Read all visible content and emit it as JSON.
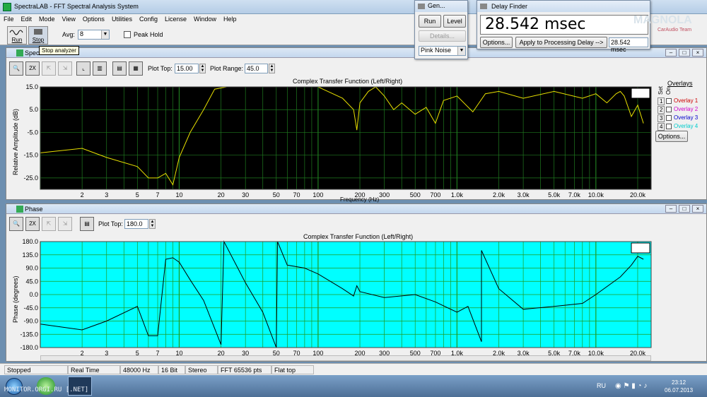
{
  "app": {
    "title": "SpectraLAB - FFT Spectral Analysis System"
  },
  "menu": [
    "File",
    "Edit",
    "Mode",
    "View",
    "Options",
    "Utilities",
    "Config",
    "License",
    "Window",
    "Help"
  ],
  "toolbar": {
    "run_label": "Run",
    "stop_label": "Stop",
    "avg_label": "Avg:",
    "avg_value": "8",
    "peak_hold_label": "Peak Hold",
    "tooltip": "Stop analyzer"
  },
  "gen": {
    "title": "Gen...",
    "run": "Run",
    "level": "Level",
    "details": "Details...",
    "noise": "Pink Noise"
  },
  "delay": {
    "title": "Delay Finder",
    "readout": "28.542 msec",
    "options": "Options...",
    "apply": "Apply to Processing Delay -->",
    "value": "28.542 msec"
  },
  "watermark": {
    "line1": "MAGNOLA",
    "line2": "CarAudio Team"
  },
  "spectrum": {
    "title": "Spectrum",
    "plot_top_label": "Plot Top:",
    "plot_top": "15.00",
    "plot_range_label": "Plot Range:",
    "plot_range": "45.0",
    "chart_title": "Complex Transfer Function (Left/Right)",
    "ylabel": "Relative Amplitude (dB)",
    "xlabel": "Frequency (Hz)",
    "yticks": [
      "15.0",
      "5.0",
      "-5.0",
      "-15.0",
      "-25.0"
    ],
    "set_label": "Set",
    "on_label": "On",
    "overlays_label": "Overlays",
    "overlays": [
      {
        "num": "1",
        "name": "Overlay 1",
        "color": "#cc0000"
      },
      {
        "num": "2",
        "name": "Overlay 2",
        "color": "#cc00cc"
      },
      {
        "num": "3",
        "name": "Overlay 3",
        "color": "#0000cc"
      },
      {
        "num": "4",
        "name": "Overlay 4",
        "color": "#00cccc"
      }
    ],
    "options_btn": "Options..."
  },
  "phase": {
    "title": "Phase",
    "plot_top_label": "Plot Top:",
    "plot_top": "180.0",
    "chart_title": "Complex Transfer Function (Left/Right)",
    "ylabel": "Phase (degrees)",
    "yticks": [
      "180.0",
      "135.0",
      "90.0",
      "45.0",
      "0.0",
      "-45.0",
      "-90.0",
      "-135.0",
      "-180.0"
    ]
  },
  "xticks": [
    "2",
    "3",
    "5",
    "7",
    "10",
    "20",
    "30",
    "50",
    "70",
    "100",
    "200",
    "300",
    "500",
    "700",
    "1.0k",
    "2.0k",
    "3.0k",
    "5.0k",
    "7.0k",
    "10.0k",
    "20.0k"
  ],
  "colors": {
    "spectrum_bg": "#000000",
    "spectrum_grid": "#1f7a1f",
    "spectrum_trace": "#e8e000",
    "phase_bg": "#00ffff",
    "phase_grid": "#1f9a1f",
    "phase_trace": "#000000"
  },
  "chart_data": [
    {
      "type": "line",
      "title": "Complex Transfer Function (Left/Right)",
      "xlabel": "Frequency (Hz)",
      "ylabel": "Relative Amplitude (dB)",
      "xscale": "log",
      "xlim": [
        1,
        25000
      ],
      "ylim": [
        -30,
        15
      ],
      "grid": true,
      "x": [
        1,
        2,
        3,
        5,
        6,
        7,
        8,
        9,
        10,
        12,
        15,
        18,
        22,
        100,
        150,
        180,
        190,
        200,
        230,
        260,
        300,
        350,
        400,
        500,
        600,
        700,
        800,
        1000,
        1300,
        1600,
        2000,
        3000,
        5000,
        8000,
        10000,
        12000,
        14000,
        15000,
        16000,
        18000,
        20000,
        22000
      ],
      "values": [
        -14,
        -12,
        -16,
        -20,
        -25,
        -25,
        -23,
        -28,
        -16,
        -5,
        5,
        14,
        15,
        15,
        10,
        5,
        -4,
        8,
        13,
        15,
        11,
        5,
        8,
        3,
        6,
        -1,
        9,
        11,
        4,
        12,
        13,
        10,
        13,
        10,
        12,
        8,
        12,
        13,
        11,
        2,
        7,
        -1
      ]
    },
    {
      "type": "line",
      "title": "Complex Transfer Function (Left/Right)",
      "ylabel": "Phase (degrees)",
      "xscale": "log",
      "xlim": [
        1,
        25000
      ],
      "ylim": [
        -180,
        180
      ],
      "grid": true,
      "x": [
        1,
        2,
        3,
        5,
        6,
        7,
        8,
        9,
        10,
        12,
        15,
        20,
        21,
        30,
        40,
        50,
        51,
        60,
        80,
        100,
        150,
        180,
        190,
        200,
        300,
        500,
        700,
        1000,
        1200,
        1500,
        1501,
        2000,
        3000,
        5000,
        8000,
        10000,
        15000,
        18000,
        20000,
        22000
      ],
      "values": [
        -100,
        -120,
        -90,
        -40,
        -140,
        -140,
        120,
        125,
        110,
        50,
        -20,
        -170,
        180,
        40,
        -60,
        -180,
        180,
        100,
        90,
        70,
        20,
        -5,
        30,
        10,
        -10,
        0,
        -25,
        -60,
        -40,
        -160,
        150,
        20,
        -50,
        -40,
        -30,
        0,
        60,
        100,
        130,
        120
      ]
    }
  ]
}
